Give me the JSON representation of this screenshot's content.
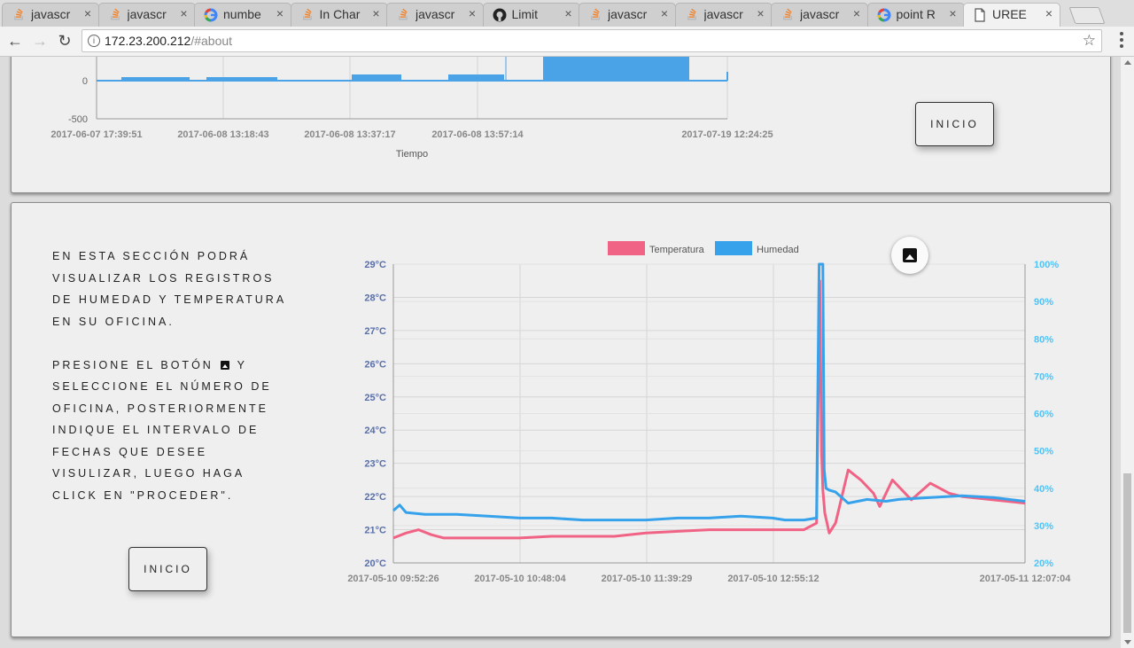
{
  "browser": {
    "tabs": [
      {
        "label": "javascr",
        "icon": "stackoverflow-icon"
      },
      {
        "label": "javascr",
        "icon": "stackoverflow-icon"
      },
      {
        "label": "numbe",
        "icon": "google-icon"
      },
      {
        "label": "In Char",
        "icon": "stackoverflow-icon"
      },
      {
        "label": "javascr",
        "icon": "stackoverflow-icon"
      },
      {
        "label": "Limit",
        "icon": "github-icon"
      },
      {
        "label": "javascr",
        "icon": "stackoverflow-icon"
      },
      {
        "label": "javascr",
        "icon": "stackoverflow-icon"
      },
      {
        "label": "javascr",
        "icon": "stackoverflow-icon"
      },
      {
        "label": "point R",
        "icon": "google-icon"
      },
      {
        "label": "UREE",
        "icon": "document-icon",
        "active": true
      }
    ],
    "close_glyph": "×",
    "url_host": "172.23.200.212",
    "url_path": "/#about"
  },
  "top_card": {
    "button_label": "INICIO"
  },
  "bottom_card": {
    "paragraph1": "En esta sección podrá visualizar los registros de humedad y temperatura en su oficina.",
    "paragraph2_before": "Presione el botón",
    "paragraph2_after": "y seleccione el número de oficina, posteriormente indique el intervalo de fechas que desee visulizar, luego haga click en \"proceder\".",
    "button_label": "INICIO"
  },
  "chart_data": [
    {
      "type": "area",
      "ylim": [
        -500,
        0
      ],
      "y_ticks": [
        "0",
        "-500"
      ],
      "x_ticks": [
        "2017-06-07 17:39:51",
        "2017-06-08 13:18:43",
        "2017-06-08 13:37:17",
        "2017-06-08 13:57:14",
        "2017-07-19 12:24:25"
      ],
      "xlabel": "Tiempo",
      "series_color": "#4aa3e6"
    },
    {
      "type": "line",
      "legend": [
        "Temperatura",
        "Humedad"
      ],
      "legend_position": "top",
      "x_ticks": [
        "2017-05-10 09:52:26",
        "2017-05-10 10:48:04",
        "2017-05-10 11:39:29",
        "2017-05-10 12:55:12",
        "2017-05-11 12:07:04"
      ],
      "y_left_ticks": [
        "20°C",
        "21°C",
        "22°C",
        "23°C",
        "24°C",
        "25°C",
        "26°C",
        "27°C",
        "28°C",
        "29°C"
      ],
      "y_left_range": [
        20,
        29
      ],
      "y_right_ticks": [
        "20%",
        "30%",
        "40%",
        "50%",
        "60%",
        "70%",
        "80%",
        "90%",
        "100%"
      ],
      "y_right_range": [
        20,
        100
      ],
      "series": [
        {
          "name": "Temperatura",
          "color": "#f06384",
          "x": [
            0,
            0.02,
            0.04,
            0.06,
            0.08,
            0.1,
            0.15,
            0.2,
            0.25,
            0.3,
            0.35,
            0.4,
            0.45,
            0.5,
            0.55,
            0.6,
            0.65,
            0.67,
            0.675,
            0.678,
            0.68,
            0.683,
            0.69,
            0.7,
            0.72,
            0.74,
            0.76,
            0.77,
            0.79,
            0.8,
            0.82,
            0.85,
            0.88,
            0.9,
            0.95,
            1.0
          ],
          "y": [
            20.75,
            20.9,
            21.0,
            20.85,
            20.75,
            20.75,
            20.75,
            20.75,
            20.8,
            20.8,
            20.8,
            20.9,
            20.95,
            21.0,
            21.0,
            21.0,
            21.0,
            21.2,
            28.5,
            23.3,
            22.2,
            21.5,
            20.9,
            21.2,
            22.8,
            22.5,
            22.1,
            21.7,
            22.5,
            22.3,
            21.9,
            22.4,
            22.1,
            22.0,
            21.9,
            21.8
          ]
        },
        {
          "name": "Humedad",
          "color": "#36a2eb",
          "x": [
            0,
            0.01,
            0.02,
            0.05,
            0.1,
            0.15,
            0.2,
            0.25,
            0.3,
            0.35,
            0.4,
            0.45,
            0.5,
            0.55,
            0.6,
            0.62,
            0.65,
            0.67,
            0.674,
            0.676,
            0.68,
            0.682,
            0.685,
            0.69,
            0.7,
            0.72,
            0.75,
            0.78,
            0.8,
            0.85,
            0.9,
            0.95,
            1.0
          ],
          "y": [
            34.0,
            35.5,
            33.5,
            33.0,
            33.0,
            32.5,
            32.0,
            32.0,
            31.5,
            31.5,
            31.5,
            32.0,
            32.0,
            32.5,
            32.0,
            31.5,
            31.5,
            32.0,
            100,
            100,
            100,
            45.0,
            40.0,
            39.5,
            39.0,
            36.0,
            37.0,
            36.5,
            37.0,
            37.5,
            38.0,
            37.5,
            36.5
          ]
        }
      ]
    }
  ]
}
